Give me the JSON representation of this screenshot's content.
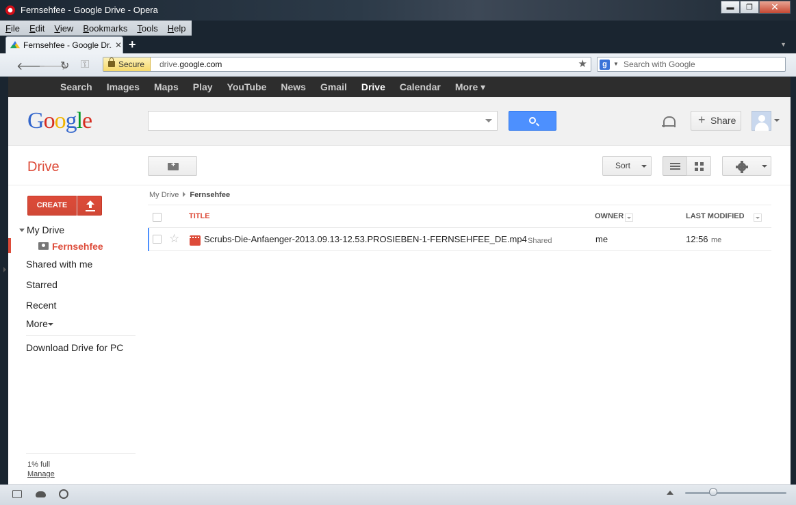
{
  "window": {
    "title": "Fernsehfee - Google Drive - Opera",
    "controls": {
      "minimize": "▬",
      "maximize": "❐",
      "close": "✕"
    }
  },
  "menu": [
    "File",
    "Edit",
    "View",
    "Bookmarks",
    "Tools",
    "Help"
  ],
  "tab": {
    "title": "Fernsehfee - Google Dr...",
    "close": "✕",
    "new_tab": "+"
  },
  "address_bar": {
    "secure_label": "Secure",
    "url_prefix": "drive.",
    "url_domain": "google.com",
    "search_placeholder": "Search with Google",
    "search_badge": "g"
  },
  "google_bar": {
    "items": [
      "Search",
      "Images",
      "Maps",
      "Play",
      "YouTube",
      "News",
      "Gmail",
      "Drive",
      "Calendar",
      "More ▾"
    ],
    "active": "Drive"
  },
  "header": {
    "logo": [
      "G",
      "o",
      "o",
      "g",
      "l",
      "e"
    ],
    "search_value": "",
    "share_label": "Share",
    "share_plus": "+"
  },
  "toolbar": {
    "app_title": "Drive",
    "sort_label": "Sort"
  },
  "sidebar": {
    "create_label": "CREATE",
    "my_drive": "My Drive",
    "current_folder": "Fernsehfee",
    "items": [
      "Shared with me",
      "Starred",
      "Recent",
      "More"
    ],
    "download": "Download Drive for PC",
    "quota": "1% full",
    "manage": "Manage"
  },
  "breadcrumb": {
    "root": "My Drive",
    "current": "Fernsehfee"
  },
  "file_list": {
    "columns": {
      "title": "TITLE",
      "owner": "OWNER",
      "modified": "LAST MODIFIED"
    },
    "rows": [
      {
        "name": "Scrubs-Die-Anfaenger-2013.09.13-12.53.PROSIEBEN-1-FERNSEHFEE_DE.mp4",
        "tag": "Shared",
        "owner": "me",
        "modified_time": "12:56",
        "modified_by": "me",
        "star": "☆"
      }
    ]
  },
  "colors": {
    "accent_red": "#dd4b39",
    "blue": "#4d90fe",
    "gbar": "#2d2d2d"
  }
}
